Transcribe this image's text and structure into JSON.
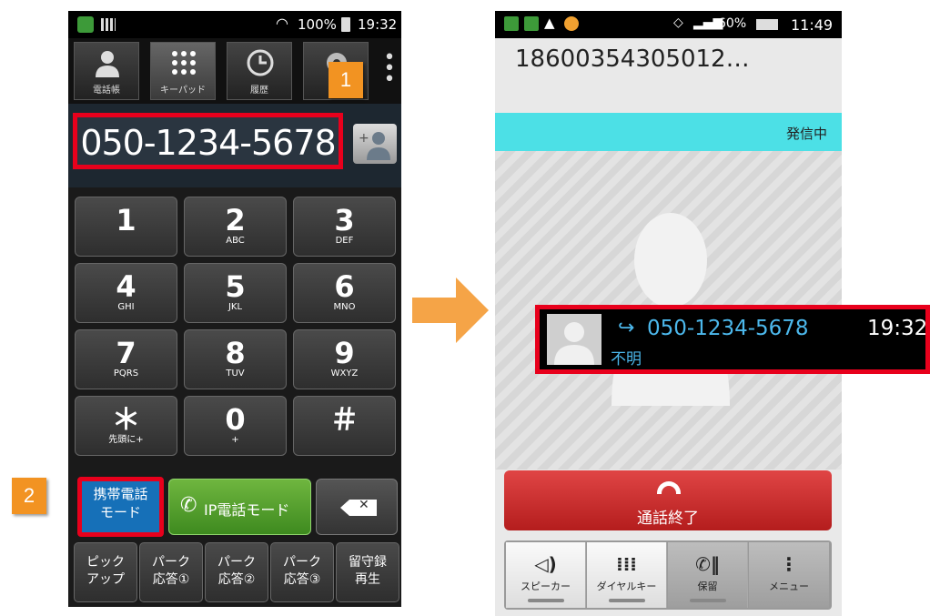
{
  "left_phone": {
    "status": {
      "battery_pct": "100%",
      "time": "19:32"
    },
    "tabs": [
      {
        "label": "電話帳",
        "icon": "person-icon"
      },
      {
        "label": "キーパッド",
        "icon": "keypad-icon"
      },
      {
        "label": "履歴",
        "icon": "clock-icon"
      }
    ],
    "dialed_number": "050-1234-5678",
    "keys": [
      {
        "digit": "1",
        "sub": ""
      },
      {
        "digit": "2",
        "sub": "ABC"
      },
      {
        "digit": "3",
        "sub": "DEF"
      },
      {
        "digit": "4",
        "sub": "GHI"
      },
      {
        "digit": "5",
        "sub": "JKL"
      },
      {
        "digit": "6",
        "sub": "MNO"
      },
      {
        "digit": "7",
        "sub": "PQRS"
      },
      {
        "digit": "8",
        "sub": "TUV"
      },
      {
        "digit": "9",
        "sub": "WXYZ"
      },
      {
        "digit": "＊",
        "sub": "先頭に+"
      },
      {
        "digit": "0",
        "sub": "+"
      },
      {
        "digit": "＃",
        "sub": ""
      }
    ],
    "mobile_mode": {
      "line1": "携帯電話",
      "line2": "モード"
    },
    "ip_mode_label": "IP電話モード",
    "bottom_buttons": [
      {
        "line1": "ピック",
        "line2": "アップ"
      },
      {
        "line1": "パーク",
        "line2": "応答①"
      },
      {
        "line1": "パーク",
        "line2": "応答②"
      },
      {
        "line1": "パーク",
        "line2": "応答③"
      },
      {
        "line1": "留守録",
        "line2": "再生"
      }
    ]
  },
  "badges": {
    "one": "1",
    "two": "2"
  },
  "right_phone": {
    "status": {
      "time": "11:49",
      "battery_pct": "60%"
    },
    "caller_number": "18600354305012…",
    "calling_status": "発信中",
    "popup": {
      "number": "050-1234-5678",
      "time": "19:32",
      "status": "不明"
    },
    "end_call_label": "通話終了",
    "controls": [
      {
        "label": "スピーカー",
        "icon": "speaker-mute-icon"
      },
      {
        "label": "ダイヤルキー",
        "icon": "dialpad-icon"
      },
      {
        "label": "保留",
        "icon": "hold-icon"
      },
      {
        "label": "メニュー",
        "icon": "menu-icon"
      }
    ]
  },
  "colors": {
    "highlight": "#e8001c",
    "badge": "#f29322",
    "calling_bar": "#4ce0e6",
    "accent_blue": "#4cb8ec"
  }
}
